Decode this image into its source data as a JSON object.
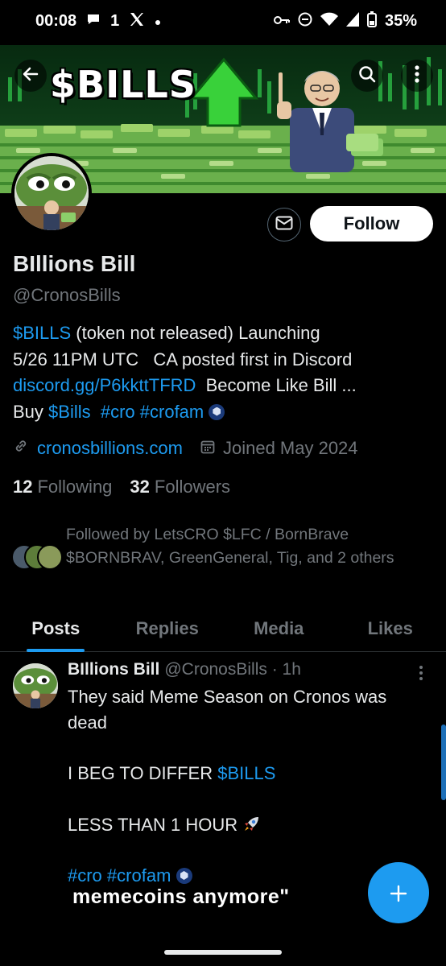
{
  "status_bar": {
    "time": "00:08",
    "notif_count": "1",
    "battery": "35%"
  },
  "header": {
    "banner_text": "$BILLS"
  },
  "profile": {
    "name": "BIllions Bill",
    "handle": "@CronosBills",
    "follow_label": "Follow",
    "bio": {
      "line1_link": "$BILLS",
      "line1_rest": " (token not released)  Launching",
      "line2": "5/26 11PM UTC   CA posted first in Discord",
      "line3_link": "discord.gg/P6kkttTFRD",
      "line3_rest": "  Become Like Bill ...",
      "line4_prefix": "Buy ",
      "line4_link1": "$Bills",
      "line4_link2": "#cro",
      "line4_link3": "#crofam"
    },
    "website": "cronosbillions.com",
    "joined": "Joined May 2024",
    "following_count": "12",
    "following_label": "Following",
    "followers_count": "32",
    "followers_label": "Followers",
    "followed_by": "Followed by LetsCRO $LFC / BornBrave $BORNBRAV, GreenGeneral, Tig, and 2 others"
  },
  "tabs": [
    {
      "label": "Posts",
      "active": true
    },
    {
      "label": "Replies",
      "active": false
    },
    {
      "label": "Media",
      "active": false
    },
    {
      "label": "Likes",
      "active": false
    }
  ],
  "post": {
    "name": "BIllions Bill",
    "handle_time": "@CronosBills · 1h",
    "line1": "They said Meme Season on Cronos was dead",
    "line2_prefix": "I BEG TO DIFFER ",
    "line2_link": "$BILLS",
    "line3": "LESS THAN 1 HOUR",
    "tag1": "#cro",
    "tag2": "#crofam",
    "caption_overlay": "memecoins anymore\""
  },
  "colors": {
    "accent": "#1d9bf0",
    "muted": "#71767b",
    "text": "#e7e9ea"
  },
  "icons": [
    "back-arrow-icon",
    "search-icon",
    "more-vertical-icon",
    "message-icon",
    "link-icon",
    "calendar-icon",
    "compose-plus-icon"
  ]
}
